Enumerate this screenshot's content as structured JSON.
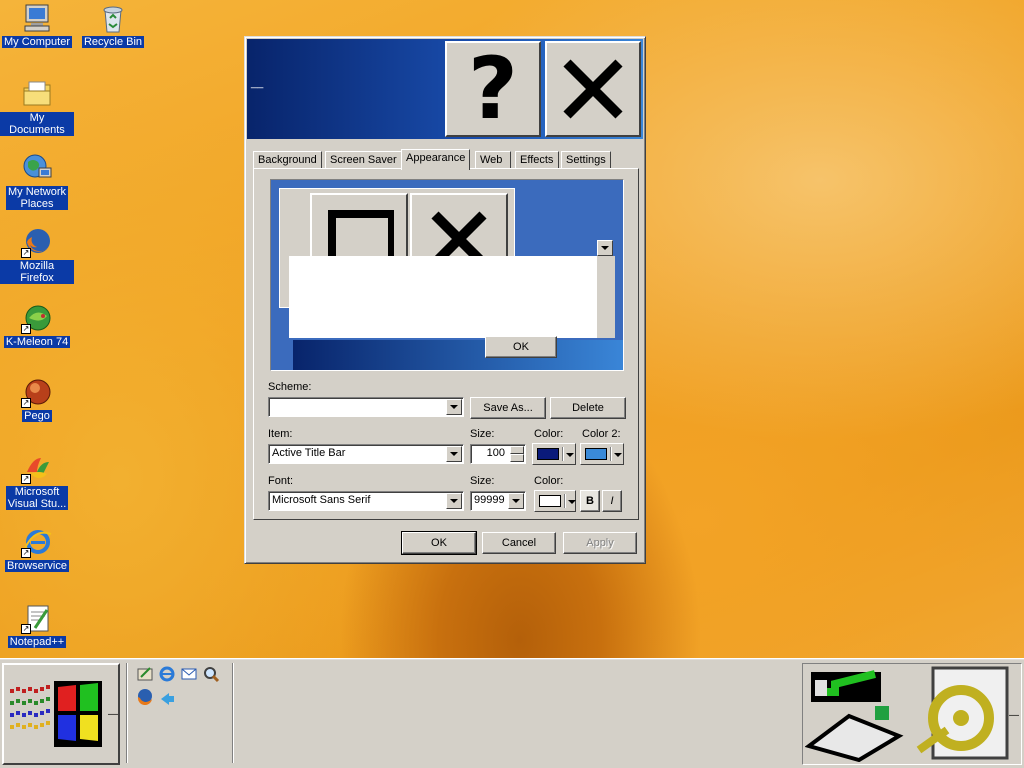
{
  "desktop": {
    "icons": [
      {
        "label": "My Computer"
      },
      {
        "label": "Recycle Bin"
      },
      {
        "label": "My Documents"
      },
      {
        "label": "My Network\nPlaces"
      },
      {
        "label": "Mozilla Firefox"
      },
      {
        "label": "K-Meleon 74"
      },
      {
        "label": "Pego"
      },
      {
        "label": "Microsoft\nVisual Stu..."
      },
      {
        "label": "Browservice"
      },
      {
        "label": "Notepad++"
      }
    ]
  },
  "dialog": {
    "title": "__",
    "help_glyph": "?",
    "tabs": [
      {
        "label": "Background"
      },
      {
        "label": "Screen Saver"
      },
      {
        "label": "Appearance"
      },
      {
        "label": "Web"
      },
      {
        "label": "Effects"
      },
      {
        "label": "Settings"
      }
    ],
    "active_tab": "Appearance",
    "preview": {
      "ok_label": "OK"
    },
    "scheme": {
      "label": "Scheme:",
      "value": ""
    },
    "save_as_label": "Save As...",
    "delete_label": "Delete",
    "item": {
      "label": "Item:",
      "value": "Active Title Bar"
    },
    "item_size": {
      "label": "Size:",
      "value": "100"
    },
    "item_color": {
      "label": "Color:",
      "hex": "#0a1a7a"
    },
    "item_color2": {
      "label": "Color 2:",
      "hex": "#3a8ad8"
    },
    "font": {
      "label": "Font:",
      "value": "Microsoft Sans Serif"
    },
    "font_size": {
      "label": "Size:",
      "value": "99999"
    },
    "font_color": {
      "label": "Color:",
      "hex": "#ffffff"
    },
    "bold_label": "B",
    "italic_label": "I",
    "ok_label": "OK",
    "cancel_label": "Cancel",
    "apply_label": "Apply"
  },
  "taskbar": {
    "start_suffix": "—",
    "tray_suffix": "—"
  },
  "colors": {
    "desktop_label_bg": "#0b3aa6",
    "titlebar_start": "#08246b",
    "titlebar_end": "#3a86d8",
    "face": "#d4d0c8"
  }
}
